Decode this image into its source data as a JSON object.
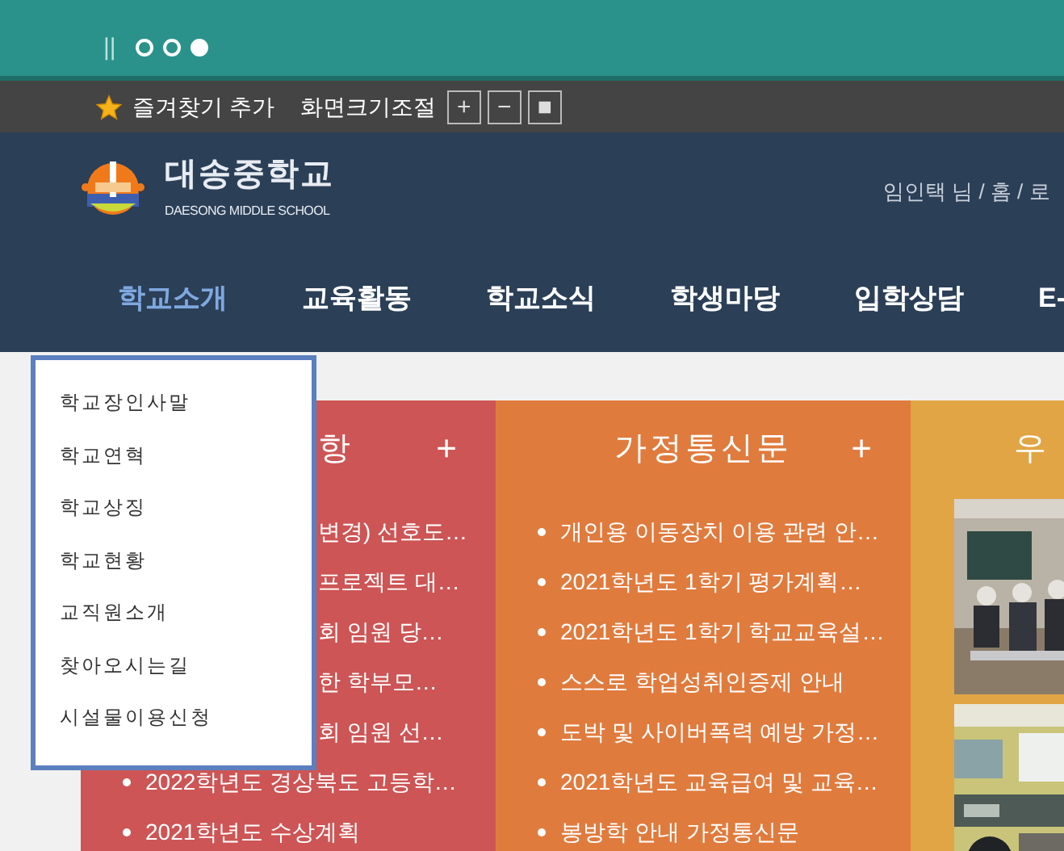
{
  "top_bar": {
    "pause": "||",
    "slides": [
      {
        "selected": false
      },
      {
        "selected": false
      },
      {
        "selected": true
      }
    ]
  },
  "utility_bar": {
    "favorite": "즐겨찾기 추가",
    "zoom_label": "화면크기조절",
    "zoom_buttons": [
      "+",
      "−",
      "■"
    ]
  },
  "header": {
    "school_name": "대송중학교",
    "school_subtitle": "DAESONG MIDDLE SCHOOL",
    "user_links": "임인택 님 / 홈 / 로"
  },
  "nav": [
    {
      "label": "학교소개",
      "selected": true
    },
    {
      "label": "교육활동",
      "selected": false
    },
    {
      "label": "학교소식",
      "selected": false
    },
    {
      "label": "학생마당",
      "selected": false
    },
    {
      "label": "입학상담",
      "selected": false
    },
    {
      "label": "E-",
      "selected": false
    }
  ],
  "dropdown": [
    "학교장인사말",
    "학교연혁",
    "학교상징",
    "학교현황",
    "교직원소개",
    "찾아오시는길",
    "시설물이용신청"
  ],
  "panels": [
    {
      "kind": "list",
      "color": "#cd5555",
      "title": "항",
      "more": "+",
      "items": [
        {
          "kind": "clipped",
          "text": "변경) 선호도…"
        },
        {
          "kind": "clipped",
          "text": "프로젝트 대…"
        },
        {
          "kind": "clipped",
          "text": "회 임원 당…"
        },
        {
          "kind": "clipped",
          "text": "한 학부모…"
        },
        {
          "kind": "clipped",
          "text": "회 임원 선…"
        },
        {
          "kind": "full",
          "text": "2022학년도 경상북도 고등학…"
        },
        {
          "kind": "full",
          "text": "2021학년도 수상계획"
        }
      ]
    },
    {
      "kind": "list",
      "color": "#e07b3e",
      "title": "가정통신문",
      "more": "+",
      "items": [
        {
          "kind": "full",
          "text": "개인용 이동장치 이용 관련 안…"
        },
        {
          "kind": "full",
          "text": "2021학년도 1학기 평가계획…"
        },
        {
          "kind": "full",
          "text": "2021학년도 1학기 학교교육설…"
        },
        {
          "kind": "full",
          "text": "스스로 학업성취인증제 안내"
        },
        {
          "kind": "full",
          "text": "도박 및 사이버폭력 예방 가정…"
        },
        {
          "kind": "full",
          "text": "2021학년도 교육급여 및 교육…"
        },
        {
          "kind": "full",
          "text": "봉방학 안내 가정통신문"
        }
      ]
    },
    {
      "kind": "gallery",
      "color": "#e2a545",
      "title": "우"
    }
  ]
}
